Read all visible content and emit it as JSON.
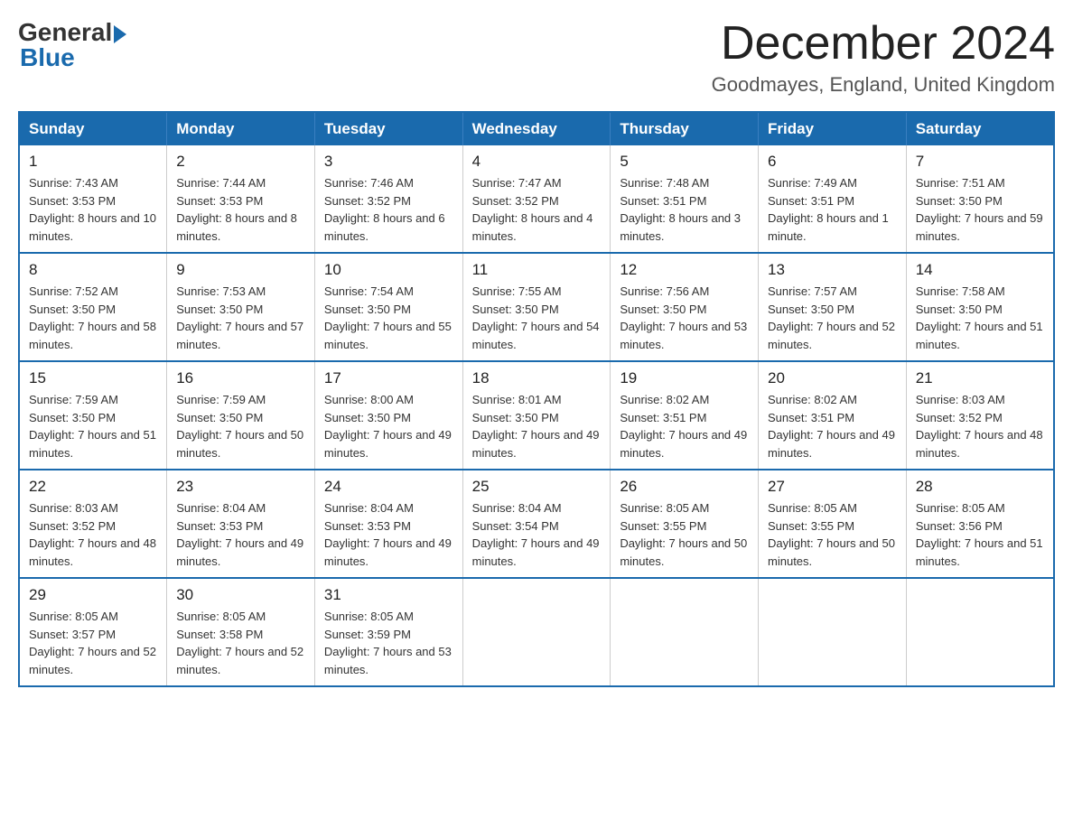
{
  "header": {
    "logo_general": "General",
    "logo_blue": "Blue",
    "month_title": "December 2024",
    "subtitle": "Goodmayes, England, United Kingdom"
  },
  "days_of_week": [
    "Sunday",
    "Monday",
    "Tuesday",
    "Wednesday",
    "Thursday",
    "Friday",
    "Saturday"
  ],
  "weeks": [
    [
      {
        "day": "1",
        "sunrise": "7:43 AM",
        "sunset": "3:53 PM",
        "daylight": "8 hours and 10 minutes."
      },
      {
        "day": "2",
        "sunrise": "7:44 AM",
        "sunset": "3:53 PM",
        "daylight": "8 hours and 8 minutes."
      },
      {
        "day": "3",
        "sunrise": "7:46 AM",
        "sunset": "3:52 PM",
        "daylight": "8 hours and 6 minutes."
      },
      {
        "day": "4",
        "sunrise": "7:47 AM",
        "sunset": "3:52 PM",
        "daylight": "8 hours and 4 minutes."
      },
      {
        "day": "5",
        "sunrise": "7:48 AM",
        "sunset": "3:51 PM",
        "daylight": "8 hours and 3 minutes."
      },
      {
        "day": "6",
        "sunrise": "7:49 AM",
        "sunset": "3:51 PM",
        "daylight": "8 hours and 1 minute."
      },
      {
        "day": "7",
        "sunrise": "7:51 AM",
        "sunset": "3:50 PM",
        "daylight": "7 hours and 59 minutes."
      }
    ],
    [
      {
        "day": "8",
        "sunrise": "7:52 AM",
        "sunset": "3:50 PM",
        "daylight": "7 hours and 58 minutes."
      },
      {
        "day": "9",
        "sunrise": "7:53 AM",
        "sunset": "3:50 PM",
        "daylight": "7 hours and 57 minutes."
      },
      {
        "day": "10",
        "sunrise": "7:54 AM",
        "sunset": "3:50 PM",
        "daylight": "7 hours and 55 minutes."
      },
      {
        "day": "11",
        "sunrise": "7:55 AM",
        "sunset": "3:50 PM",
        "daylight": "7 hours and 54 minutes."
      },
      {
        "day": "12",
        "sunrise": "7:56 AM",
        "sunset": "3:50 PM",
        "daylight": "7 hours and 53 minutes."
      },
      {
        "day": "13",
        "sunrise": "7:57 AM",
        "sunset": "3:50 PM",
        "daylight": "7 hours and 52 minutes."
      },
      {
        "day": "14",
        "sunrise": "7:58 AM",
        "sunset": "3:50 PM",
        "daylight": "7 hours and 51 minutes."
      }
    ],
    [
      {
        "day": "15",
        "sunrise": "7:59 AM",
        "sunset": "3:50 PM",
        "daylight": "7 hours and 51 minutes."
      },
      {
        "day": "16",
        "sunrise": "7:59 AM",
        "sunset": "3:50 PM",
        "daylight": "7 hours and 50 minutes."
      },
      {
        "day": "17",
        "sunrise": "8:00 AM",
        "sunset": "3:50 PM",
        "daylight": "7 hours and 49 minutes."
      },
      {
        "day": "18",
        "sunrise": "8:01 AM",
        "sunset": "3:50 PM",
        "daylight": "7 hours and 49 minutes."
      },
      {
        "day": "19",
        "sunrise": "8:02 AM",
        "sunset": "3:51 PM",
        "daylight": "7 hours and 49 minutes."
      },
      {
        "day": "20",
        "sunrise": "8:02 AM",
        "sunset": "3:51 PM",
        "daylight": "7 hours and 49 minutes."
      },
      {
        "day": "21",
        "sunrise": "8:03 AM",
        "sunset": "3:52 PM",
        "daylight": "7 hours and 48 minutes."
      }
    ],
    [
      {
        "day": "22",
        "sunrise": "8:03 AM",
        "sunset": "3:52 PM",
        "daylight": "7 hours and 48 minutes."
      },
      {
        "day": "23",
        "sunrise": "8:04 AM",
        "sunset": "3:53 PM",
        "daylight": "7 hours and 49 minutes."
      },
      {
        "day": "24",
        "sunrise": "8:04 AM",
        "sunset": "3:53 PM",
        "daylight": "7 hours and 49 minutes."
      },
      {
        "day": "25",
        "sunrise": "8:04 AM",
        "sunset": "3:54 PM",
        "daylight": "7 hours and 49 minutes."
      },
      {
        "day": "26",
        "sunrise": "8:05 AM",
        "sunset": "3:55 PM",
        "daylight": "7 hours and 50 minutes."
      },
      {
        "day": "27",
        "sunrise": "8:05 AM",
        "sunset": "3:55 PM",
        "daylight": "7 hours and 50 minutes."
      },
      {
        "day": "28",
        "sunrise": "8:05 AM",
        "sunset": "3:56 PM",
        "daylight": "7 hours and 51 minutes."
      }
    ],
    [
      {
        "day": "29",
        "sunrise": "8:05 AM",
        "sunset": "3:57 PM",
        "daylight": "7 hours and 52 minutes."
      },
      {
        "day": "30",
        "sunrise": "8:05 AM",
        "sunset": "3:58 PM",
        "daylight": "7 hours and 52 minutes."
      },
      {
        "day": "31",
        "sunrise": "8:05 AM",
        "sunset": "3:59 PM",
        "daylight": "7 hours and 53 minutes."
      },
      null,
      null,
      null,
      null
    ]
  ]
}
